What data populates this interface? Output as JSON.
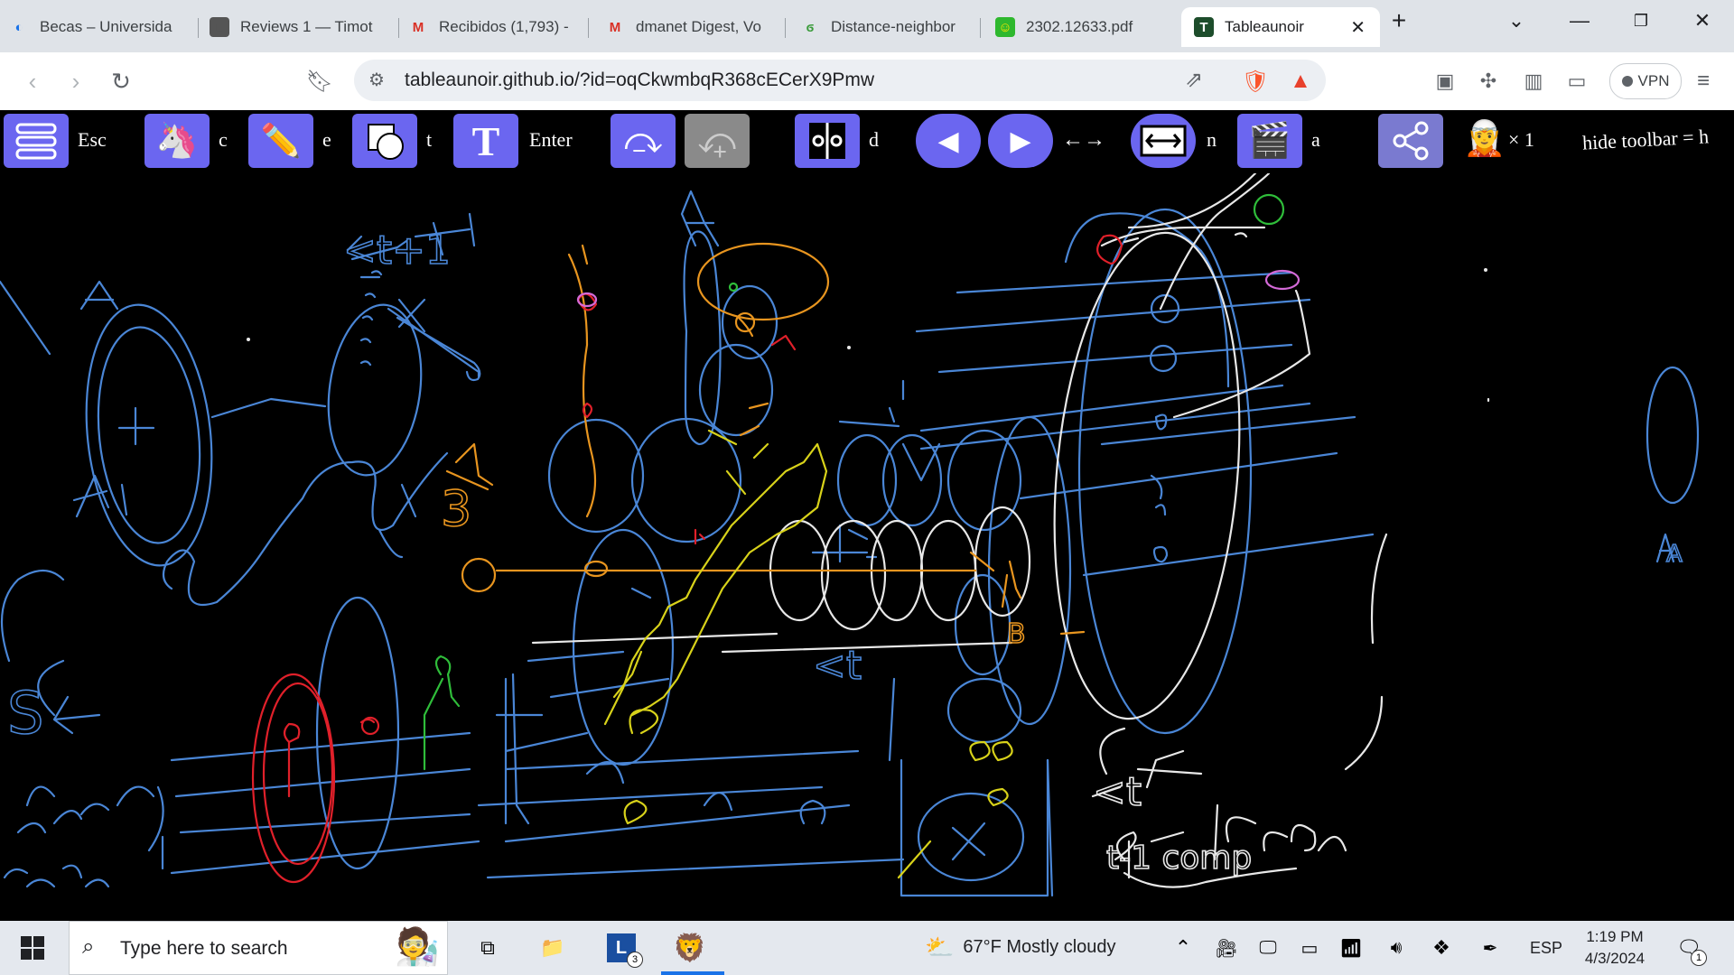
{
  "browser": {
    "tabs": [
      {
        "title": "Becas – Universida",
        "icon": "university-icon"
      },
      {
        "title": "Reviews 1 — Timot",
        "icon": "openreview-icon"
      },
      {
        "title": "Recibidos (1,793) -",
        "icon": "gmail-icon"
      },
      {
        "title": "dmanet Digest, Vo",
        "icon": "gmail-icon"
      },
      {
        "title": "Distance-neighbor",
        "icon": "overleaf-icon"
      },
      {
        "title": "2302.12633.pdf",
        "icon": "pdf-icon"
      },
      {
        "title": "Tableaunoir",
        "icon": "tableaunoir-icon",
        "active": true
      }
    ],
    "url": "tableaunoir.github.io/?id=oqCkwmbqR368cECerX9Pmw",
    "vpn_label": "VPN"
  },
  "toolbar": {
    "menu_key": "Esc",
    "magnet_key": "c",
    "eraser_key": "e",
    "shape_key": "t",
    "text_key": "Enter",
    "mirror_key": "d",
    "arrows": "←→",
    "fit_key": "n",
    "animation_key": "a",
    "participants": "× 1",
    "hide_hint": "hide toolbar = h"
  },
  "board": {
    "labels": [
      "<t+1",
      "A",
      "A",
      "A",
      "A",
      "<t",
      "<t",
      "t-1 comp",
      "S",
      "3",
      "B"
    ],
    "colors": {
      "blue": "#4a86d6",
      "white": "#e8e8e8",
      "orange": "#e8951f",
      "yellow": "#d8d21a",
      "red": "#e0202a",
      "green": "#2fbd3a",
      "pink": "#d46ad8"
    }
  },
  "taskbar": {
    "search_placeholder": "Type here to search",
    "weather": "67°F  Mostly cloudy",
    "language": "ESP",
    "time": "1:19 PM",
    "date": "4/3/2024",
    "notifications": "1",
    "app_badge": "3"
  }
}
